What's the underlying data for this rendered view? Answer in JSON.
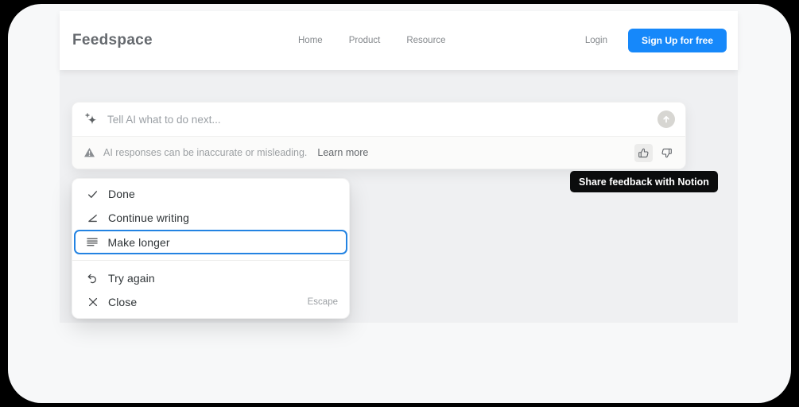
{
  "header": {
    "logo": "Feedspace",
    "nav": {
      "items": [
        {
          "label": "Home"
        },
        {
          "label": "Product"
        },
        {
          "label": "Resource"
        }
      ]
    },
    "login_label": "Login",
    "signup_label": "Sign Up for free"
  },
  "ai_box": {
    "placeholder": "Tell AI what to do next...",
    "warning_text": "AI responses can be inaccurate or misleading.",
    "learn_more_label": "Learn more"
  },
  "tooltip": {
    "text": "Share feedback with Notion"
  },
  "menu": {
    "items": [
      {
        "label": "Done"
      },
      {
        "label": "Continue writing"
      },
      {
        "label": "Make longer",
        "selected": true
      },
      {
        "label": "Try again"
      },
      {
        "label": "Close",
        "shortcut": "Escape"
      }
    ]
  },
  "colors": {
    "signup_blue": "#1688fa",
    "selection_blue": "#2383e2",
    "tooltip_bg": "#0b0c0d",
    "hero_gray": "#eff0f2"
  }
}
